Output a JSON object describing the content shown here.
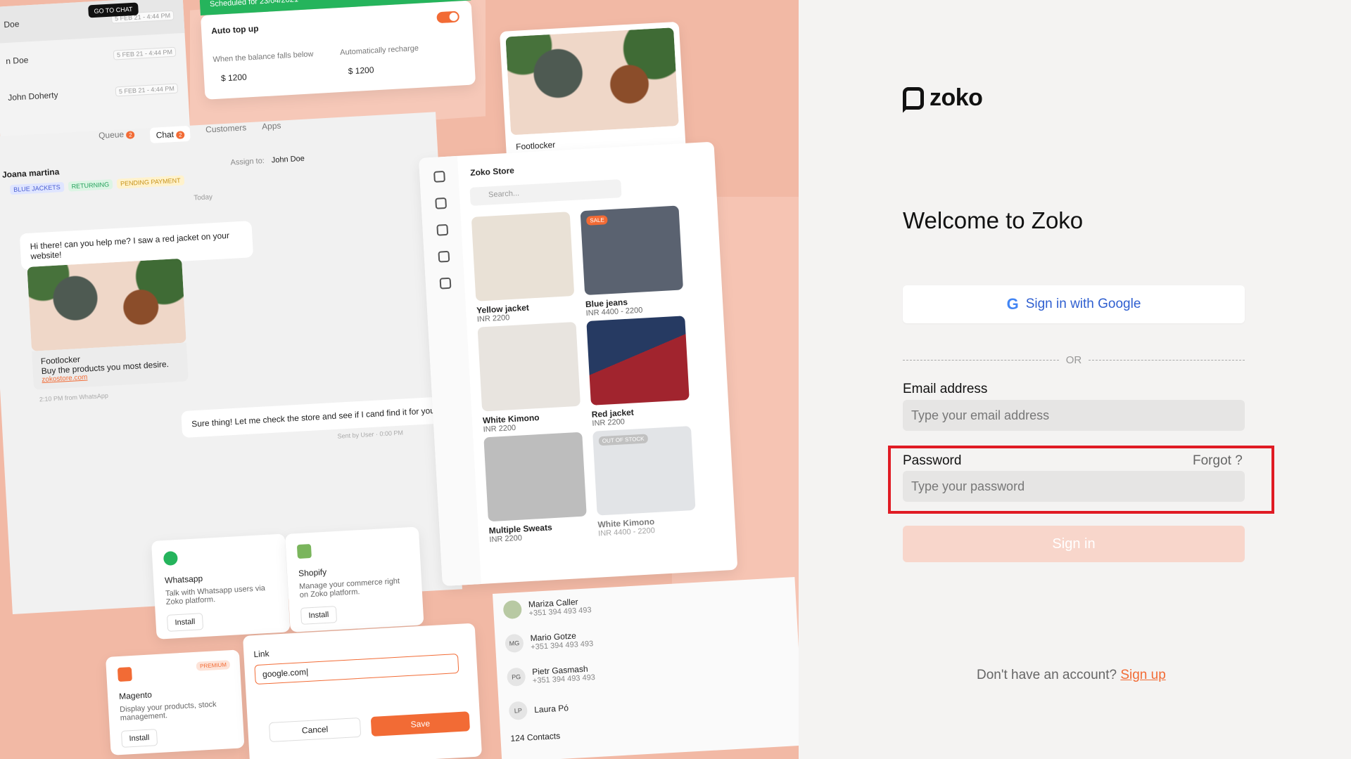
{
  "hero": {
    "chat_list": [
      {
        "name": "Doe",
        "date": "5 FEB 21 - 4:44 PM"
      },
      {
        "name": "n Doe",
        "date": "5 FEB 21 - 4:44 PM"
      },
      {
        "name": "John Doherty",
        "date": "5 FEB 21 - 4:44 PM"
      }
    ],
    "tooltip": "GO TO CHAT",
    "topup": {
      "banner": "Scheduled for 23/04/2021",
      "title": "Auto top up",
      "sub1": "When the balance falls below",
      "val1": "$ 1200",
      "sub2": "Automatically recharge",
      "val2": "$ 1200"
    },
    "tabs": {
      "queue": "Queue",
      "queue_count": "2",
      "chat": "Chat",
      "chat_count": "2",
      "customers": "Customers",
      "apps": "Apps"
    },
    "customer": "Joana martina",
    "tags": [
      "BLUE JACKETS",
      "RETURNING",
      "PENDING PAYMENT"
    ],
    "assign_label": "Assign to:",
    "assign_value": "John Doe",
    "today": "Today",
    "msg_in": "Hi there! can you help me? I saw a red jacket on your website!",
    "fl_title": "Footlocker",
    "fl_desc": "Buy the products you most desire.",
    "fl_link": "zokostore.com",
    "msg_meta": "2:10 PM from WhatsApp",
    "msg_out": "Sure thing! Let me check the store and see if I cand find it for you.",
    "msg_out_meta": "Sent by User · 0:00 PM",
    "store": {
      "title": "Zoko Store",
      "search": "Search...",
      "products": [
        {
          "name": "Yellow jacket",
          "price": "INR 2200"
        },
        {
          "name": "Blue jeans",
          "price": "INR 4400 - 2200"
        },
        {
          "name": "White Kimono",
          "price": "INR 2200"
        },
        {
          "name": "Red jacket",
          "price": "INR 2200"
        },
        {
          "name": "Multiple Sweats",
          "price": "INR 2200"
        },
        {
          "name": "White Kimono",
          "price": "INR 4400 - 2200"
        }
      ],
      "sale": "SALE",
      "out_of_stock": "OUT OF STOCK"
    },
    "integrations": [
      {
        "name": "Whatsapp",
        "desc": "Talk with Whatsapp users via Zoko platform.",
        "btn": "Install"
      },
      {
        "name": "Shopify",
        "desc": "Manage your commerce right on Zoko platform.",
        "btn": "Install"
      },
      {
        "name": "Magento",
        "desc": "Display your products, stock management.",
        "btn": "Install",
        "badge": "PREMIUM"
      }
    ],
    "link_card": {
      "label": "Link",
      "value": "google.com|",
      "cancel": "Cancel",
      "save": "Save"
    },
    "contacts": [
      {
        "name": "Mariza Caller",
        "phone": "+351 394 493 493",
        "initials": ""
      },
      {
        "name": "Mario Gotze",
        "phone": "+351 394 493 493",
        "initials": "MG"
      },
      {
        "name": "Pietr Gasmash",
        "phone": "+351 394 493 493",
        "initials": "PG"
      },
      {
        "name": "Laura Pó",
        "phone": "",
        "initials": "LP"
      }
    ],
    "contacts_count": "124 Contacts"
  },
  "login": {
    "brand": "zoko",
    "welcome": "Welcome to Zoko",
    "google_btn": "Sign in with Google",
    "or": "OR",
    "email_label": "Email address",
    "email_placeholder": "Type your email address",
    "password_label": "Password",
    "forgot": "Forgot ?",
    "password_placeholder": "Type your password",
    "signin": "Sign in",
    "no_account": "Don't have an account?",
    "signup": "Sign up"
  },
  "colors": {
    "accent": "#f26b35",
    "hero_bg": "#f2b9a5",
    "google_blue": "#2f5fd0",
    "highlight": "#e01b24",
    "signin_disabled": "#f8d6cb"
  }
}
